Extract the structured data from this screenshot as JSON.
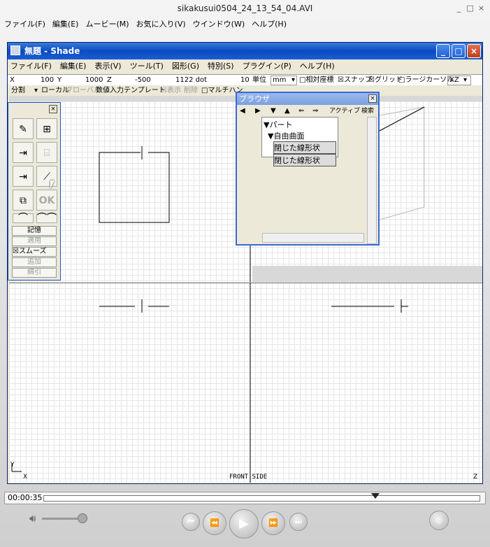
{
  "player": {
    "title": "sikakusui0504_24_13_54_04.AVI",
    "menu": [
      "ファイル(F)",
      "編集(E)",
      "ムービー(M)",
      "お気に入り(V)",
      "ウインドウ(W)",
      "ヘルプ(H)"
    ],
    "time": "00:00:35",
    "min": "_",
    "max": "□",
    "close": "×"
  },
  "shade": {
    "title": "無題 - Shade",
    "menu": [
      "ファイル(F)",
      "編集(E)",
      "表示(V)",
      "ツール(T)",
      "図形(G)",
      "特別(S)",
      "プラグイン(P)",
      "ヘルプ(H)"
    ],
    "coords": {
      "x_label": "X",
      "x": "100",
      "y_label": "Y",
      "y": "1000",
      "z_label": "Z",
      "z": "-500",
      "dot": "1122 dot",
      "unit_num": "10",
      "unit_label": "単位",
      "unit": "mm",
      "relative": "□相対座標",
      "snap": "☒スナップ",
      "grid": "☒グリッド",
      "large_cursor": "□ラージカーソル",
      "plane": "XZ"
    },
    "toolrow": {
      "split": "分割",
      "local": "ローカル",
      "global": "グローバル",
      "numeric": "数値入力",
      "template": "テンプレート",
      "show": "☒表示",
      "delete": "削除",
      "multi": "□マルチハン"
    },
    "view_label": "FRONT SIDE",
    "axis_x": "X",
    "axis_y": "Y",
    "axis_z": "Z"
  },
  "toolbox": {
    "memory": "記憶",
    "apply": "適用",
    "smooth": "☒スムーズ",
    "add": "追加",
    "subtract": "綿引",
    "ok": "OK"
  },
  "browser": {
    "title": "ブラウザ",
    "active": "アクティブ",
    "search": "検索",
    "tree": {
      "part": "▼パート",
      "surface": "▼自由曲面",
      "items": [
        "閉じた線形状",
        "閉じた線形状"
      ]
    }
  }
}
